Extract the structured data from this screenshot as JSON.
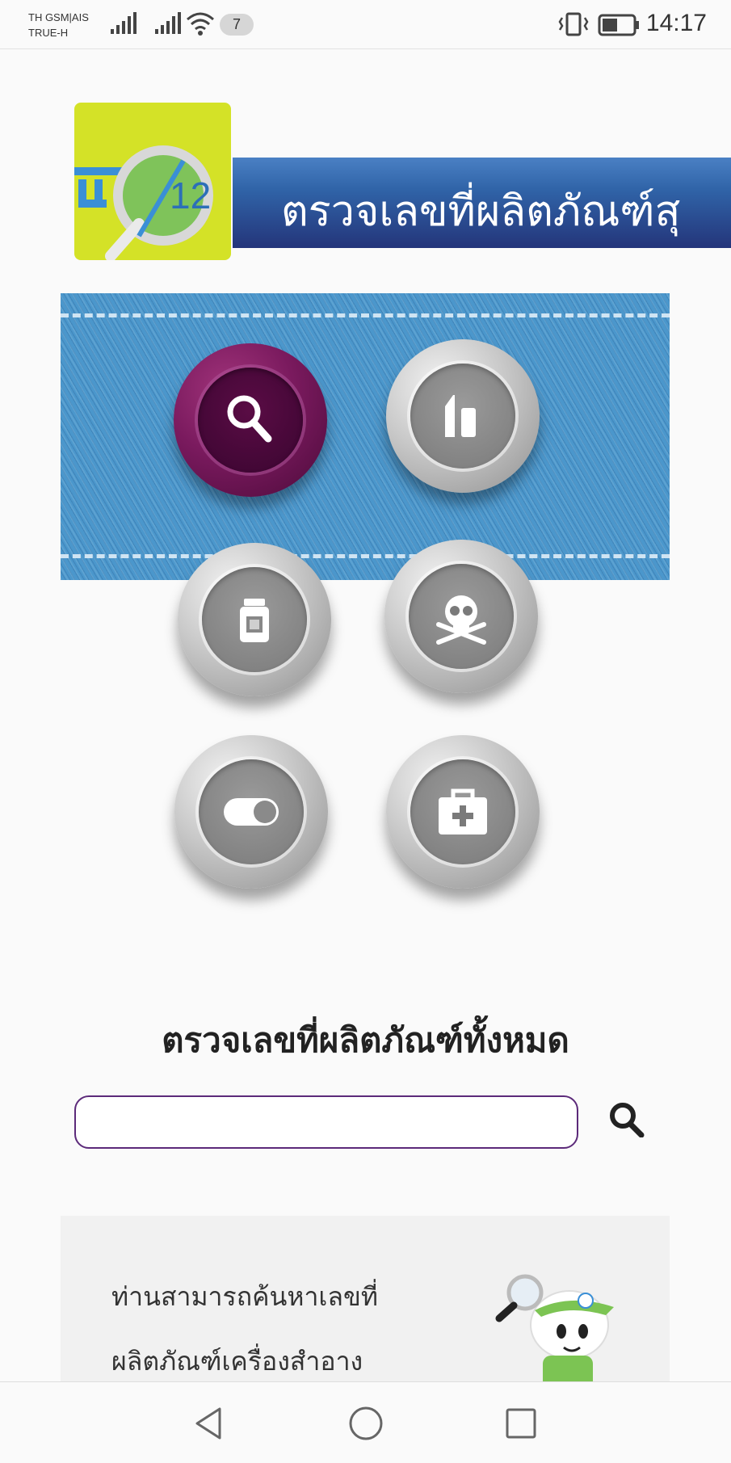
{
  "status_bar": {
    "carrier_line1": "TH GSM|AIS",
    "carrier_line2": "TRUE-H",
    "notification_count": "7",
    "time": "14:17",
    "icons": [
      "signal-icon",
      "signal-icon",
      "wifi-icon",
      "vibrate-icon",
      "battery-icon"
    ]
  },
  "header": {
    "logo_text": "12",
    "banner_title": "ตรวจเลขที่ผลิตภัณฑ์สุ"
  },
  "categories": [
    {
      "name": "search-all",
      "icon": "search-icon",
      "active": true
    },
    {
      "name": "cosmetics",
      "icon": "lipstick-icon",
      "active": false
    },
    {
      "name": "medicine",
      "icon": "medicine-bottle-icon",
      "active": false
    },
    {
      "name": "hazardous",
      "icon": "skull-icon",
      "active": false
    },
    {
      "name": "medical-device",
      "icon": "capsule-icon",
      "active": false
    },
    {
      "name": "first-aid",
      "icon": "first-aid-icon",
      "active": false
    }
  ],
  "search": {
    "title": "ตรวจเลขที่ผลิตภัณฑ์ทั้งหมด",
    "placeholder": "",
    "value": ""
  },
  "info": {
    "line1": "ท่านสามารถค้นหาเลขที่",
    "line2": "ผลิตภัณฑ์เครื่องสำอาง"
  },
  "nav": [
    "back-icon",
    "home-icon",
    "recents-icon"
  ],
  "colors": {
    "accent_purple": "#5c2a7a",
    "banner_blue": "#2c4f98",
    "denim_blue": "#4b97cc",
    "logo_yellow": "#d4e227"
  }
}
